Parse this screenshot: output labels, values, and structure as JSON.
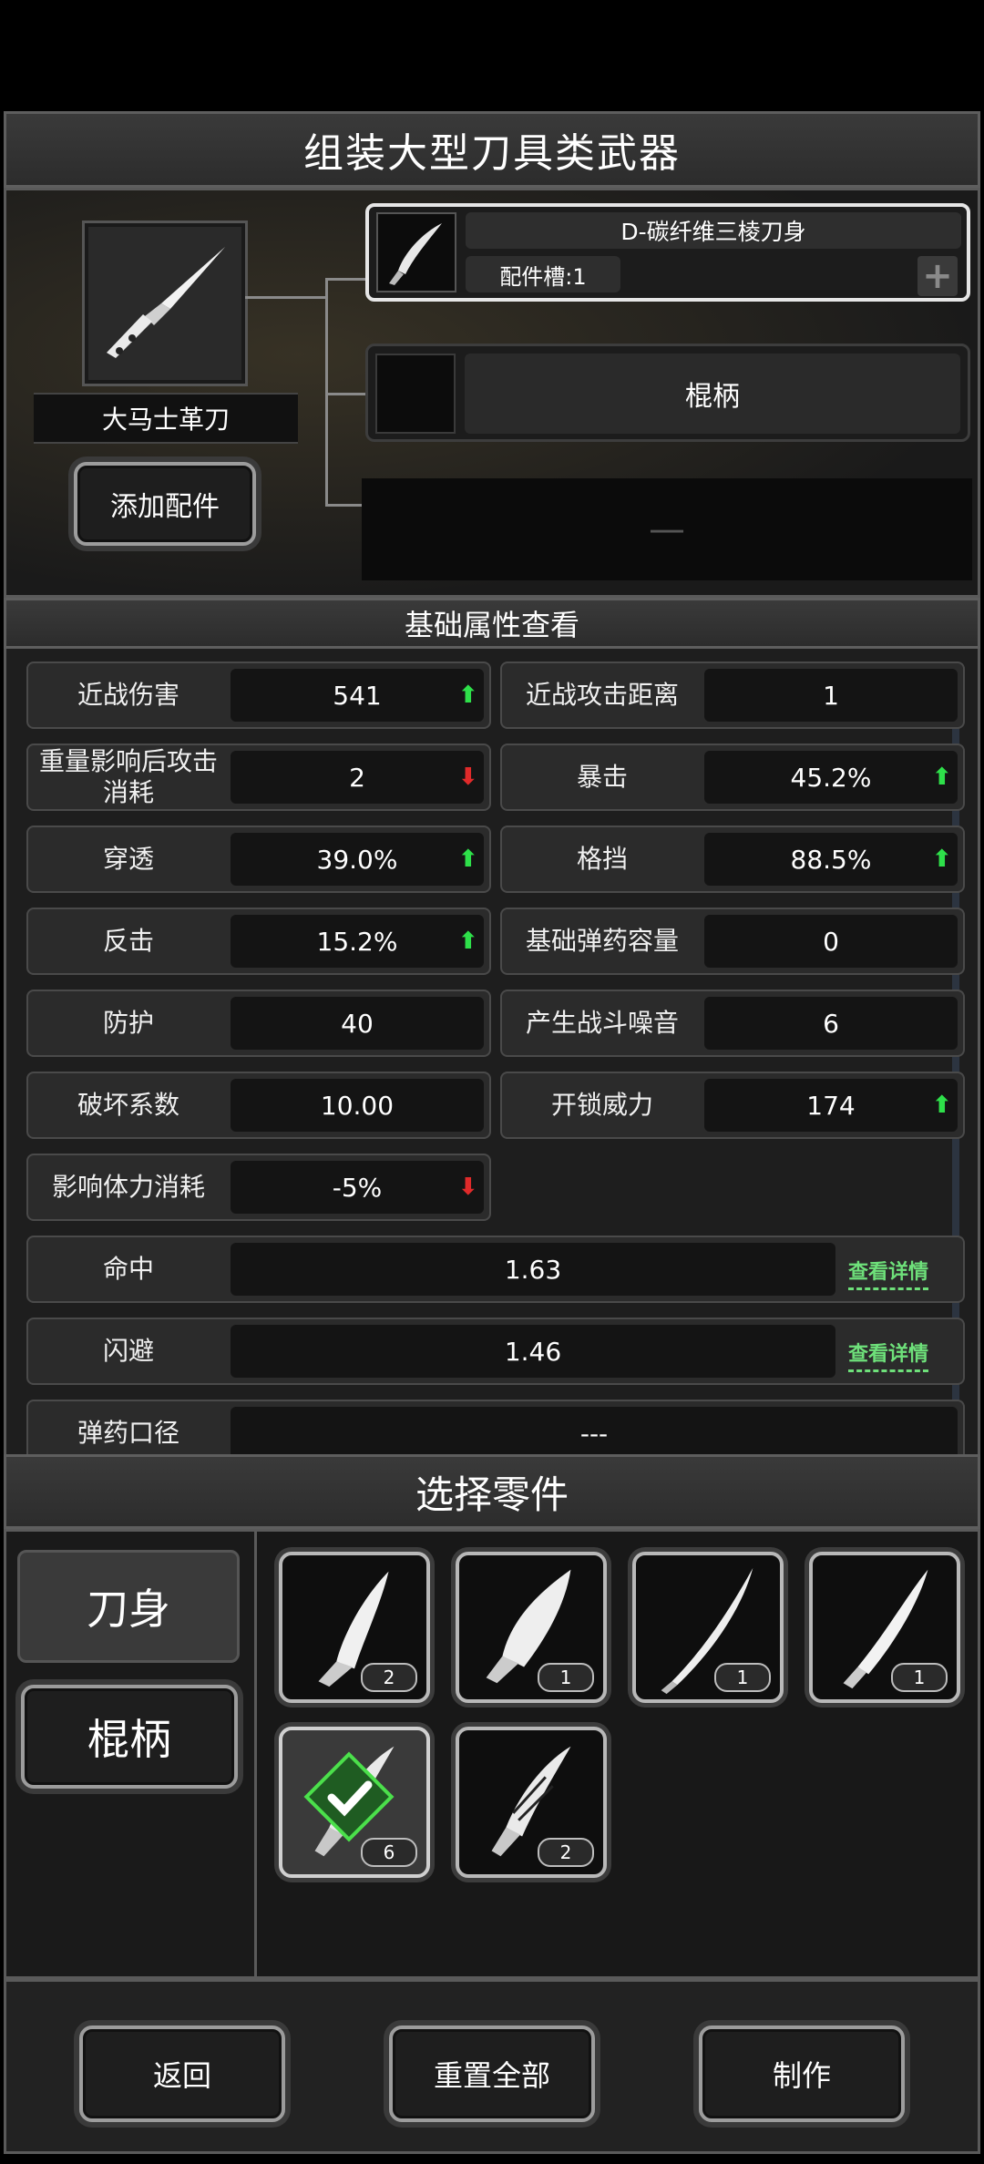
{
  "header": {
    "title": "组装大型刀具类武器"
  },
  "weapon": {
    "name": "大马士革刀",
    "add_parts_label": "添加配件"
  },
  "part_slots": [
    {
      "name": "D-碳纤维三棱刀身",
      "slot_info": "配件槽:1",
      "add_symbol": "+"
    },
    {
      "name": "棍柄"
    },
    {
      "name": "—"
    }
  ],
  "stats_section": {
    "title": "基础属性查看"
  },
  "stats": [
    {
      "label": "近战伤害",
      "value": "541",
      "trend": "up"
    },
    {
      "label": "近战攻击距离",
      "value": "1",
      "trend": ""
    },
    {
      "label": "重量影响后攻击消耗",
      "value": "2",
      "trend": "down"
    },
    {
      "label": "暴击",
      "value": "45.2%",
      "trend": "up"
    },
    {
      "label": "穿透",
      "value": "39.0%",
      "trend": "up"
    },
    {
      "label": "格挡",
      "value": "88.5%",
      "trend": "up"
    },
    {
      "label": "反击",
      "value": "15.2%",
      "trend": "up"
    },
    {
      "label": "基础弹药容量",
      "value": "0",
      "trend": ""
    },
    {
      "label": "防护",
      "value": "40",
      "trend": ""
    },
    {
      "label": "产生战斗噪音",
      "value": "6",
      "trend": ""
    },
    {
      "label": "破坏系数",
      "value": "10.00",
      "trend": ""
    },
    {
      "label": "开锁威力",
      "value": "174",
      "trend": "up"
    },
    {
      "label": "影响体力消耗",
      "value": "-5%",
      "trend": "down"
    }
  ],
  "wide_stats": [
    {
      "label": "命中",
      "value": "1.63",
      "link": "查看详情"
    },
    {
      "label": "闪避",
      "value": "1.46",
      "link": "查看详情"
    },
    {
      "label": "弹药口径",
      "value": "---",
      "link": ""
    }
  ],
  "trend_icons": {
    "up": "⬆",
    "down": "⬇"
  },
  "select_section": {
    "title": "选择零件"
  },
  "categories": [
    {
      "label": "刀身",
      "active": true
    },
    {
      "label": "棍柄",
      "active": false
    }
  ],
  "parts": [
    {
      "count": "2",
      "selected": false,
      "icon": "curved-blade-icon"
    },
    {
      "count": "1",
      "selected": false,
      "icon": "cleaver-blade-icon"
    },
    {
      "count": "1",
      "selected": false,
      "icon": "serrated-blade-icon"
    },
    {
      "count": "1",
      "selected": false,
      "icon": "long-blade-icon"
    },
    {
      "count": "6",
      "selected": true,
      "icon": "feather-blade-icon"
    },
    {
      "count": "2",
      "selected": false,
      "icon": "feather-blade-icon"
    }
  ],
  "footer": {
    "back": "返回",
    "reset": "重置全部",
    "craft": "制作"
  },
  "colors": {
    "up": "#2ee04a",
    "down": "#e02a2a",
    "link": "#6ee07a",
    "selected": "#4be04b"
  }
}
